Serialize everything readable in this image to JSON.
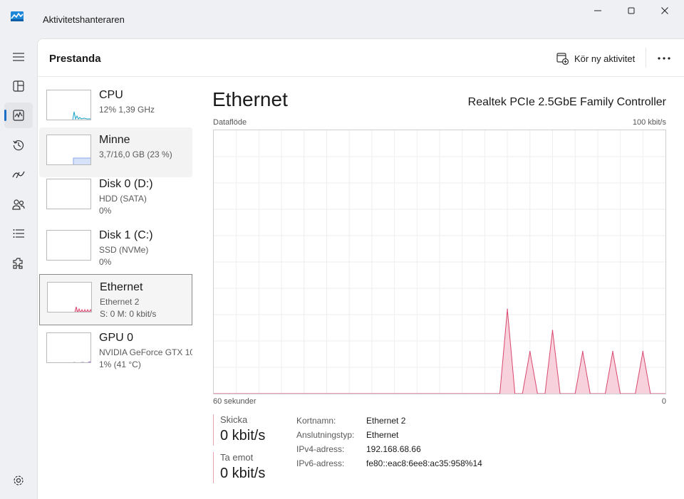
{
  "window": {
    "title": "Aktivitetshanteraren",
    "icon": "task-manager-icon",
    "minimize_icon": "minimize-icon",
    "maximize_icon": "maximize-icon",
    "close_icon": "close-icon"
  },
  "nav": {
    "items": [
      {
        "name": "menu-icon"
      },
      {
        "name": "processes-icon"
      },
      {
        "name": "performance-icon",
        "active": true
      },
      {
        "name": "app-history-icon"
      },
      {
        "name": "startup-apps-icon"
      },
      {
        "name": "users-icon"
      },
      {
        "name": "details-icon"
      },
      {
        "name": "services-icon"
      }
    ],
    "settings_icon": "settings-icon"
  },
  "header": {
    "title": "Prestanda",
    "run_task_label": "Kör ny aktivitet",
    "run_task_icon": "run-task-icon",
    "more_icon": "more-options-icon"
  },
  "resources": [
    {
      "name": "CPU",
      "sub1": "12%  1,39 GHz",
      "sub2": ""
    },
    {
      "name": "Minne",
      "sub1": "3,7/16,0 GB (23 %)",
      "sub2": ""
    },
    {
      "name": "Disk 0 (D:)",
      "sub1": "HDD (SATA)",
      "sub2": "0%"
    },
    {
      "name": "Disk 1 (C:)",
      "sub1": "SSD (NVMe)",
      "sub2": "0%"
    },
    {
      "name": "Ethernet",
      "sub1": "Ethernet 2",
      "sub2": "S: 0  M: 0 kbit/s"
    },
    {
      "name": "GPU 0",
      "sub1": "NVIDIA GeForce GTX 10",
      "sub2": "1% (41 °C)"
    }
  ],
  "detail": {
    "title": "Ethernet",
    "device": "Realtek PCIe 2.5GbE Family Controller",
    "chart_label_left": "Dataflöde",
    "chart_label_right": "100 kbit/s",
    "axis_left": "60 sekunder",
    "axis_right": "0",
    "send_label": "Skicka",
    "send_value": "0 kbit/s",
    "receive_label": "Ta emot",
    "receive_value": "0 kbit/s",
    "properties": [
      {
        "key": "Kortnamn:",
        "value": "Ethernet 2"
      },
      {
        "key": "Anslutningstyp:",
        "value": "Ethernet"
      },
      {
        "key": "IPv4-adress:",
        "value": "192.168.68.66"
      },
      {
        "key": "IPv6-adress:",
        "value": "fe80::eac8:6ee8:ac35:958%14"
      }
    ]
  },
  "colors": {
    "accent": "#1c6fc4",
    "network": "#d9476f",
    "network_fill": "#f7d2dc",
    "cpu": "#17a2c8",
    "memory": "#8aa8e6",
    "gpu": "#9a6ad6",
    "grid": "#eeeeee"
  },
  "chart_data": {
    "type": "area",
    "title": "",
    "xlabel": "60 sekunder",
    "ylabel": "Dataflöde",
    "xlim": [
      60,
      0
    ],
    "ylim": [
      0,
      100
    ],
    "unit": "kbit/s",
    "grid": true,
    "series": [
      {
        "values": [
          0,
          0,
          0,
          0,
          0,
          0,
          0,
          0,
          0,
          0,
          0,
          0,
          0,
          0,
          0,
          0,
          0,
          0,
          0,
          0,
          0,
          0,
          0,
          0,
          0,
          0,
          0,
          0,
          0,
          0,
          0,
          0,
          0,
          0,
          0,
          0,
          0,
          0,
          0,
          32,
          0,
          0,
          16,
          0,
          0,
          24,
          0,
          0,
          0,
          16,
          0,
          0,
          0,
          16,
          0,
          0,
          0,
          16,
          0,
          0,
          0
        ]
      }
    ]
  }
}
